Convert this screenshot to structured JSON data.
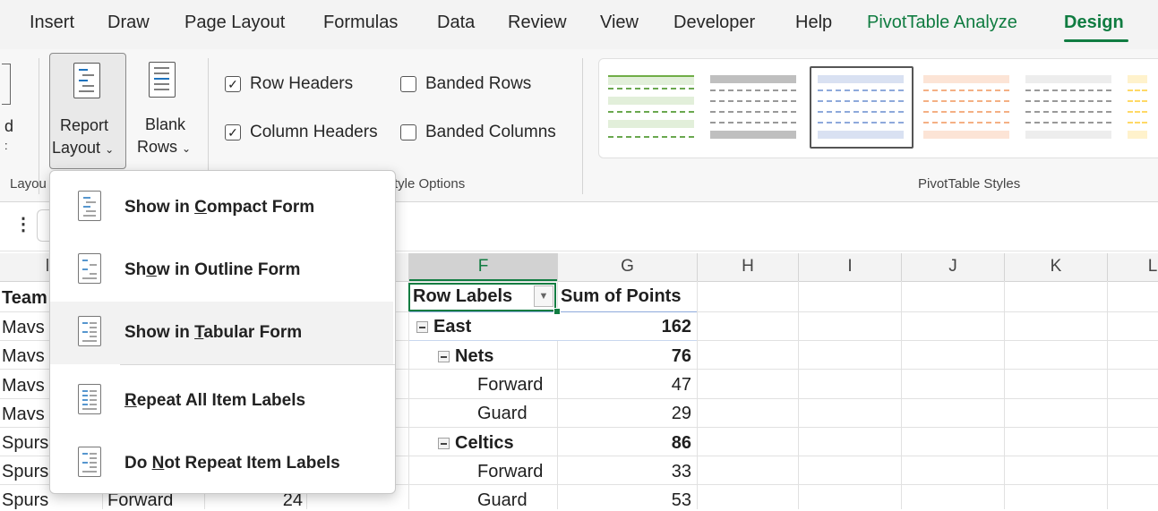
{
  "ribbon_tabs": [
    "Insert",
    "Draw",
    "Page Layout",
    "Formulas",
    "Data",
    "Review",
    "View",
    "Developer",
    "Help",
    "PivotTable Analyze",
    "Design"
  ],
  "active_tab": "Design",
  "accent_color": "#107c41",
  "layout_group": {
    "label_partial": "Layou",
    "left_btn_partial": [
      "d",
      ":"
    ],
    "report_layout": [
      "Report",
      "Layout"
    ],
    "blank_rows": [
      "Blank",
      "Rows"
    ]
  },
  "style_options": {
    "row_headers": {
      "label": "Row Headers",
      "checked": true
    },
    "column_headers": {
      "label": "Column Headers",
      "checked": true
    },
    "banded_rows": {
      "label": "Banded Rows",
      "checked": false
    },
    "banded_columns": {
      "label": "Banded Columns",
      "checked": false
    },
    "group_label_partial": "tyle Options"
  },
  "styles_group": {
    "label": "PivotTable Styles"
  },
  "formula_bar": {
    "menu_glyph": "⋮"
  },
  "columns": {
    "partial_left": "l",
    "f": "F",
    "g": "G",
    "h": "H",
    "i": "I",
    "j": "J",
    "k": "K",
    "l": "L"
  },
  "left_table": {
    "header": "Team",
    "teams": [
      "Mavs",
      "Mavs",
      "Mavs",
      "Mavs",
      "Spurs",
      "Spurs",
      "Spurs"
    ],
    "last_row": {
      "position": "Forward",
      "points": "24"
    }
  },
  "pivot": {
    "row_labels": "Row Labels",
    "sum_header": "Sum of Points",
    "rows": [
      {
        "label": "East",
        "value": "162"
      },
      {
        "label": "Nets",
        "value": "76"
      },
      {
        "label": "Forward",
        "value": "47"
      },
      {
        "label": "Guard",
        "value": "29"
      },
      {
        "label": "Celtics",
        "value": "86"
      },
      {
        "label": "Forward",
        "value": "33"
      },
      {
        "label": "Guard",
        "value": "53"
      }
    ]
  },
  "menu": {
    "items": [
      {
        "before": "Show in ",
        "key": "C",
        "after": "ompact Form"
      },
      {
        "before": "Sh",
        "key": "o",
        "after": "w in Outline Form"
      },
      {
        "before": "Show in ",
        "key": "T",
        "after": "abular Form"
      },
      {
        "before": "",
        "key": "R",
        "after": "epeat All Item Labels"
      },
      {
        "before": "Do ",
        "key": "N",
        "after": "ot Repeat Item Labels"
      }
    ]
  }
}
